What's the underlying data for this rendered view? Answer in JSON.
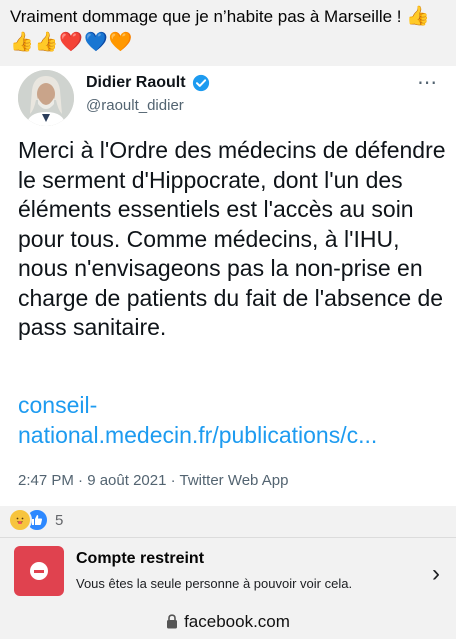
{
  "post": {
    "text": "Vraiment dommage que je n’habite pas  à Marseille !",
    "emojis": "👍👍👍❤️💙🧡"
  },
  "tweet": {
    "author_name": "Didier Raoult",
    "handle": "@raoult_didier",
    "body": "Merci à l'Ordre des médecins de défendre le serment d'Hippocrate, dont l'un des éléments essentiels est l'accès au soin pour tous. Comme médecins, à l'IHU, nous n'envisageons pas la non-prise en charge de patients du fait de l'absence de pass sanitaire.",
    "link": "conseil-national.medecin.fr/publications/c...",
    "meta": "2:47 PM · 9 août 2021 · Twitter Web App",
    "more_icon": "⋯",
    "verified_color": "#1d9bf0"
  },
  "reactions": {
    "icons": [
      "care-reaction",
      "like-reaction"
    ],
    "count": "5"
  },
  "restricted": {
    "title": "Compte restreint",
    "subtitle": "Vous êtes la seule personne à pouvoir voir cela.",
    "chevron": "›",
    "accent": "#e0424f"
  },
  "browser": {
    "url": "facebook.com"
  }
}
